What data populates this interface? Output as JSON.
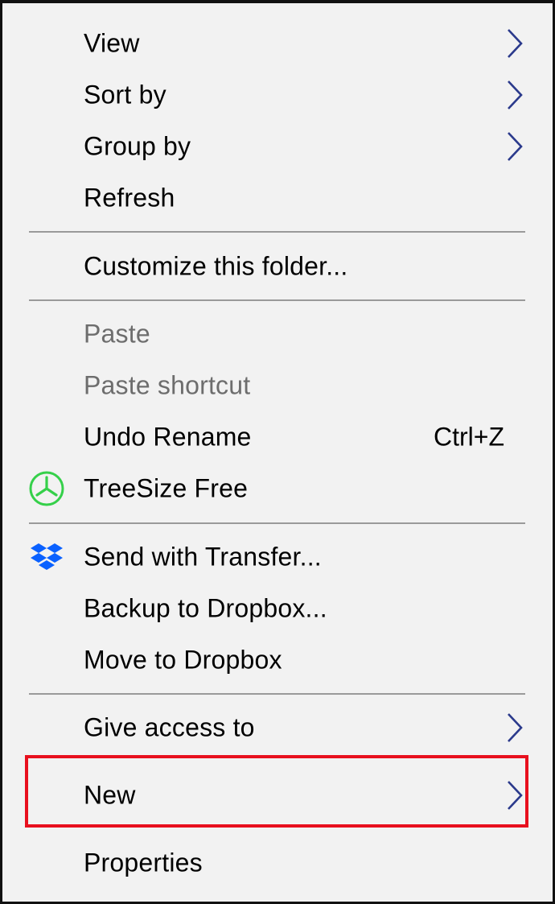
{
  "menu": {
    "items": [
      {
        "label": "View",
        "submenu": true
      },
      {
        "label": "Sort by",
        "submenu": true
      },
      {
        "label": "Group by",
        "submenu": true
      },
      {
        "label": "Refresh"
      },
      {
        "label": "Customize this folder..."
      },
      {
        "label": "Paste",
        "disabled": true
      },
      {
        "label": "Paste shortcut",
        "disabled": true
      },
      {
        "label": "Undo Rename",
        "shortcut": "Ctrl+Z"
      },
      {
        "label": "TreeSize Free",
        "icon": "treesize-icon"
      },
      {
        "label": "Send with Transfer...",
        "icon": "dropbox-icon"
      },
      {
        "label": "Backup to Dropbox..."
      },
      {
        "label": "Move to Dropbox"
      },
      {
        "label": "Give access to",
        "submenu": true
      },
      {
        "label": "New",
        "submenu": true,
        "highlighted": true
      },
      {
        "label": "Properties"
      }
    ]
  },
  "colors": {
    "menu_background": "#f2f2f2",
    "disabled_text": "#6d6d6d",
    "separator": "#9a9a9a",
    "highlight_border": "#e8101e",
    "submenu_arrow": "#2b3a8c",
    "treesize_green": "#35d04a",
    "dropbox_blue": "#0a61ff"
  }
}
